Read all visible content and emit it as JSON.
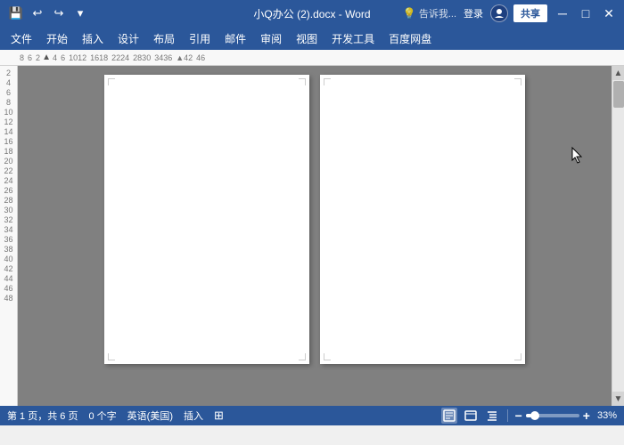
{
  "titlebar": {
    "title": "小Q办公 (2).docx - Word",
    "quickaccess": {
      "save_label": "💾",
      "undo_label": "↩",
      "redo_label": "↪",
      "dropdown_label": "▾"
    },
    "controls": {
      "minimize": "─",
      "restore": "□",
      "close": "✕"
    }
  },
  "menubar": {
    "items": [
      "文件",
      "开始",
      "插入",
      "设计",
      "布局",
      "引用",
      "邮件",
      "审阅",
      "视图",
      "开发工具",
      "百度网盘"
    ]
  },
  "tell_me": {
    "icon": "💡",
    "placeholder": "告诉我..."
  },
  "user": {
    "login_label": "登录",
    "share_label": "共享"
  },
  "ruler": {
    "marks": [
      "8",
      "6",
      "2",
      "4",
      "6",
      "10",
      "12",
      "16",
      "18",
      "22",
      "24",
      "28",
      "30",
      "34",
      "36",
      "42",
      "46"
    ],
    "arrow": "▲",
    "left_nums": [
      "2",
      "4",
      "6",
      "8",
      "10",
      "12",
      "14",
      "16",
      "18",
      "20",
      "22",
      "24",
      "26",
      "28",
      "30",
      "32",
      "34",
      "36",
      "38",
      "40",
      "42",
      "44",
      "46",
      "48"
    ]
  },
  "statusbar": {
    "page_info": "第 1 页，共 6 页",
    "word_count": "0 个字",
    "language": "英语(美国)",
    "mode": "插入",
    "view_icons": [
      "📄",
      "📊",
      "🖥",
      "📱"
    ],
    "zoom_minus": "−",
    "zoom_plus": "+",
    "zoom_level": "33%"
  },
  "colors": {
    "accent": "#2b579a",
    "page_bg": "#808080",
    "ribbon_bg": "#f3f3f3"
  }
}
